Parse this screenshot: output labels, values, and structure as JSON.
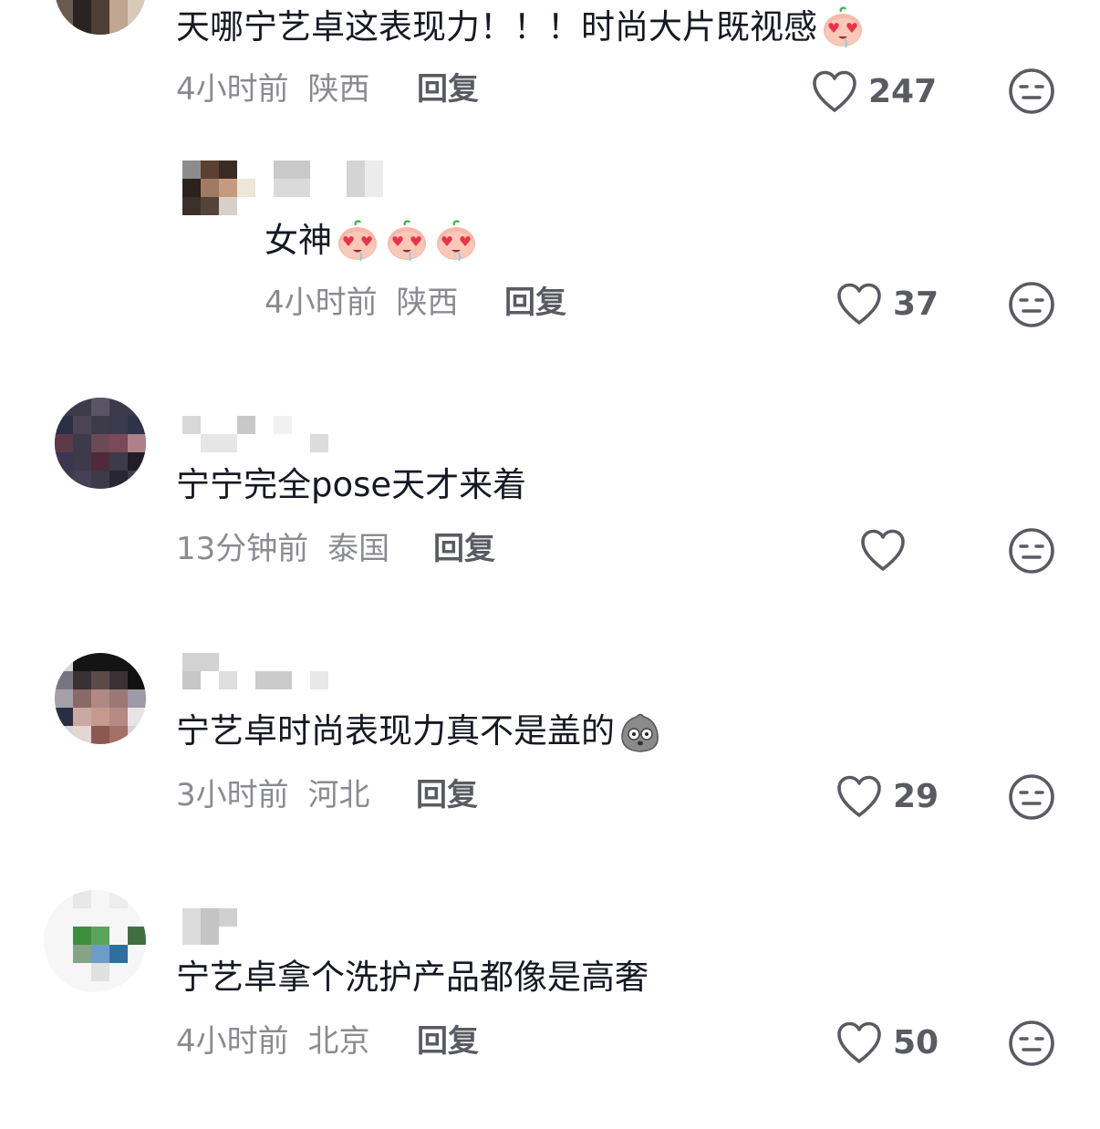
{
  "comments": [
    {
      "text": "天哪宁艺卓这表现力！！！时尚大片既视感",
      "time": "4小时前",
      "location": "陕西",
      "reply_label": "回复",
      "likes": "247"
    },
    {
      "text": "女神",
      "time": "4小时前",
      "location": "陕西",
      "reply_label": "回复",
      "likes": "37"
    },
    {
      "text": "宁宁完全pose天才来着",
      "time": "13分钟前",
      "location": "泰国",
      "reply_label": "回复",
      "likes": ""
    },
    {
      "text": "宁艺卓时尚表现力真不是盖的",
      "time": "3小时前",
      "location": "河北",
      "reply_label": "回复",
      "likes": "29"
    },
    {
      "text": "宁艺卓拿个洗护产品都像是高奢",
      "time": "4小时前",
      "location": "北京",
      "reply_label": "回复",
      "likes": "50"
    }
  ],
  "icons": {
    "like": "heart-outline-icon",
    "dislike": "neutral-face-icon",
    "emoji_heart_eyes": "heart-eyes-peach-emoji",
    "emoji_stone": "stone-face-emoji"
  },
  "colors": {
    "text": "#161823",
    "meta": "#8a8b91",
    "icon": "#5a5b62"
  }
}
